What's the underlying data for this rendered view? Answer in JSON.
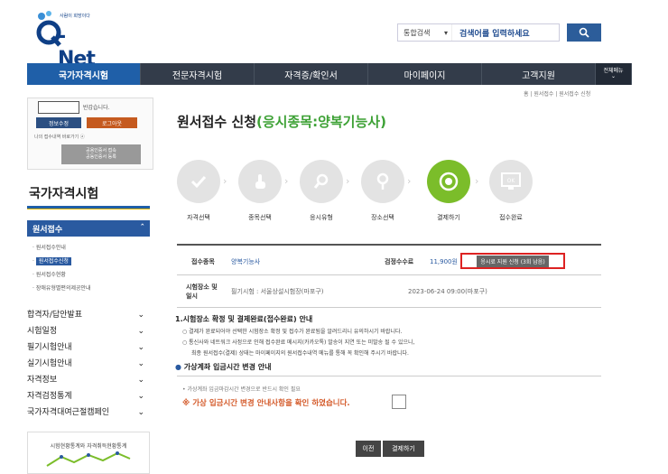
{
  "logo": {
    "tagline": "사람이 희망이다",
    "brand": "-Net",
    "q": "Q"
  },
  "search": {
    "category": "통합검색",
    "placeholder": "검색어를 입력하세요"
  },
  "nav": {
    "items": [
      "국가자격시험",
      "전문자격시험",
      "자격증/확인서",
      "마이페이지",
      "고객지원"
    ],
    "all_menu": "전체메뉴"
  },
  "user": {
    "greeting": "반갑습니다.",
    "info_edit": "정보수정",
    "logout": "로그아웃",
    "quick_link": "나의 접수내역 바로가기 ⓐ",
    "gray_btn_1": "공용인증서 접속",
    "gray_btn_2": "공동인증서 등록"
  },
  "side": {
    "heading": "국가자격시험",
    "section": "원서접수",
    "sub_items": [
      "원서접수안내",
      "원서접수신청",
      "원서접수현황",
      "장애유형별편의제공안내"
    ],
    "menu": [
      "합격자/답안발표",
      "시험일정",
      "필기시험안내",
      "실기시험안내",
      "자격정보",
      "자격검정통계",
      "국가자격대여근절캠페인"
    ],
    "stats_label": "시험현황통계와 자격취득현황통계"
  },
  "breadcrumb": "홈 | 원서접수 | 원서접수 신청",
  "title": {
    "main": "원서접수 신청",
    "highlight": "(응시종목:양복기능사)"
  },
  "steps": [
    "자격선택",
    "종목선택",
    "응시유형",
    "장소선택",
    "결제하기",
    "접수완료"
  ],
  "row1": {
    "label": "접수종목",
    "value": "양복기능사",
    "fee_label": "검정수수료",
    "fee_value": "11,900원",
    "apply_btn": "응시료 지원 신청 (3회 남음)"
  },
  "row2": {
    "label": "시험장소 및 일시",
    "place": "필기시험 : 서울상설시험장(마포구)",
    "date": "2023-06-24 09:00(마포구)"
  },
  "notice1": {
    "title": "1.시험장소 확정 및 결제완료(접수완료) 안내",
    "lines": [
      "○ 결제가 완료되어야 선택한 시험장소 확정 및 접수가 완료됨을 알려드리니 유의하시기 바랍니다.",
      "○ 통신사와 네트워크 사정으로 인해 접수완료 메시지(카카오톡) 발송이 지연 또는 미발송 될 수 있으니,",
      "최종 원서접수(결제) 상태는 마이페이지의 원서접수내역 메뉴를 통해 꼭 확인해 주시기 바랍니다."
    ]
  },
  "notice2": {
    "title": "가상계좌 입금시간 변경 안내",
    "line": "• 가상계좌 입금마감시간 변경으로 반드시 확인 필요",
    "confirm": "※ 가상 입금시간 변경 안내사항을 확인 하였습니다."
  },
  "buttons": {
    "prev": "이전",
    "pay": "결제하기"
  },
  "colors": {
    "nav_bg": "#333c4a",
    "nav_active": "#1f5fa8",
    "accent_green": "#3da135",
    "highlight_red": "#dd2222"
  }
}
